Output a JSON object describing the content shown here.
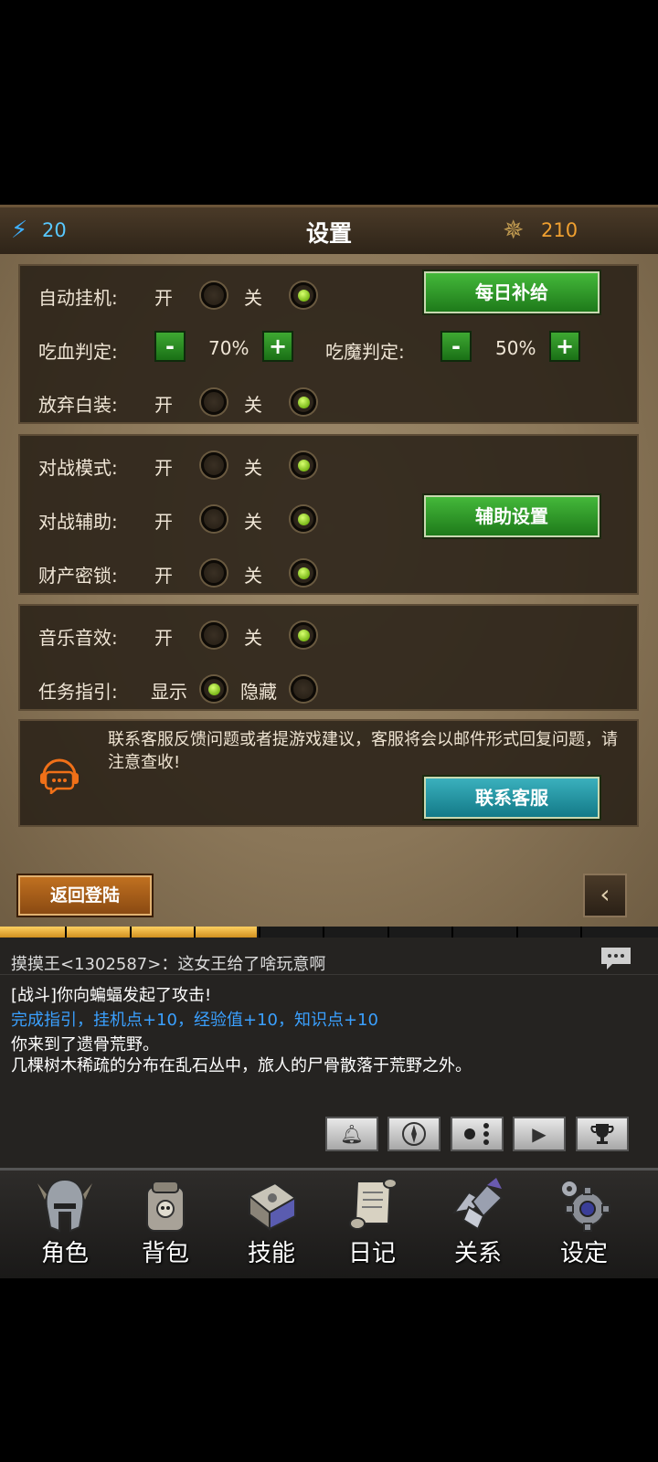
{
  "header": {
    "title": "设置",
    "energy": "20",
    "gold": "210"
  },
  "settings": {
    "auto_hang": {
      "label": "自动挂机:",
      "on": "开",
      "off": "关",
      "selected": "off"
    },
    "daily_supply": "每日补给",
    "hp_judge": {
      "label": "吃血判定:",
      "value": "70%"
    },
    "mp_judge": {
      "label": "吃魔判定:",
      "value": "50%"
    },
    "minus": "-",
    "plus": "+",
    "discard_white": {
      "label": "放弃白装:",
      "on": "开",
      "off": "关",
      "selected": "off"
    },
    "pvp_mode": {
      "label": "对战模式:",
      "on": "开",
      "off": "关",
      "selected": "off"
    },
    "pvp_assist": {
      "label": "对战辅助:",
      "on": "开",
      "off": "关",
      "selected": "off"
    },
    "assist_settings": "辅助设置",
    "property_lock": {
      "label": "财产密锁:",
      "on": "开",
      "off": "关",
      "selected": "off"
    },
    "music": {
      "label": "音乐音效:",
      "on": "开",
      "off": "关",
      "selected": "off"
    },
    "quest_guide": {
      "label": "任务指引:",
      "on": "显示",
      "off": "隐藏",
      "selected": "on"
    }
  },
  "support": {
    "notice": "联系客服反馈问题或者提游戏建议，客服将会以邮件形式回复问题，请注意查收!",
    "button": "联系客服"
  },
  "back_login": "返回登陆",
  "progress": {
    "filled_fraction": 0.39
  },
  "log": {
    "chat": "摸摸王<1302587>：这女王给了啥玩意啊",
    "lines": [
      {
        "text": "[战斗]你向蝙蝠发起了攻击!",
        "color": "#ffffff"
      },
      {
        "text": "完成指引，挂机点+10，经验值+10，知识点+10",
        "color": "#3aa0ff"
      },
      {
        "text": "你来到了遗骨荒野。",
        "color": "#ffffff"
      },
      {
        "text": "几棵树木稀疏的分布在乱石丛中，旅人的尸骨散落于荒野之外。",
        "color": "#ffffff"
      }
    ]
  },
  "toolbar": [
    "bell-icon",
    "compass-icon",
    "dots-icon",
    "play-icon",
    "trophy-icon"
  ],
  "nav": [
    {
      "label": "角色",
      "icon": "helmet-icon"
    },
    {
      "label": "背包",
      "icon": "backpack-icon"
    },
    {
      "label": "技能",
      "icon": "skillbook-icon"
    },
    {
      "label": "日记",
      "icon": "scroll-icon"
    },
    {
      "label": "关系",
      "icon": "handshake-icon"
    },
    {
      "label": "设定",
      "icon": "gear-icon"
    }
  ],
  "colors": {
    "accent_green": "#2fa028",
    "accent_teal": "#1f94a2",
    "gold": "#f0a030",
    "energy": "#58c8ff"
  }
}
